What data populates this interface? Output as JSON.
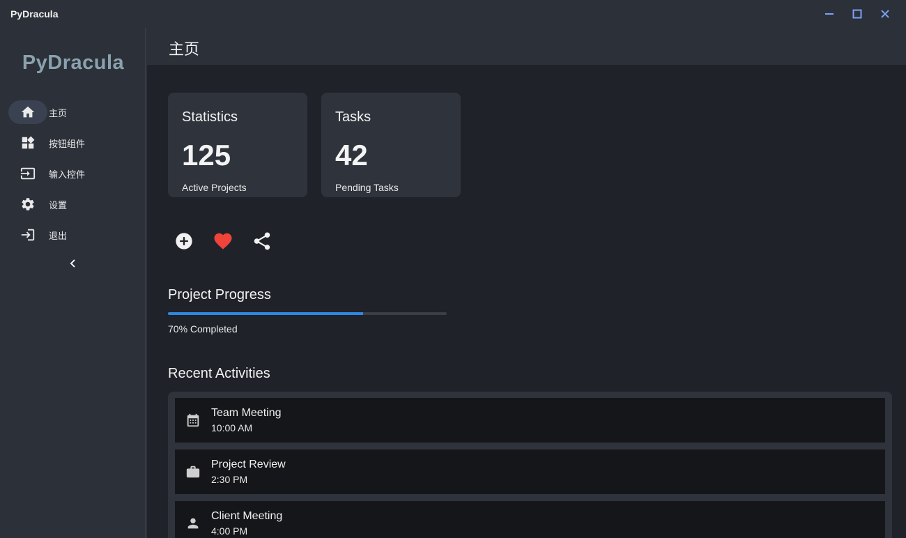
{
  "window": {
    "title": "PyDracula",
    "controls": {
      "minimize": "minimize-icon",
      "maximize": "maximize-icon",
      "close": "close-icon"
    }
  },
  "sidebar": {
    "brand": "PyDracula",
    "items": [
      {
        "label": "主页",
        "icon": "home-icon",
        "active": true
      },
      {
        "label": "按钮组件",
        "icon": "widgets-icon",
        "active": false
      },
      {
        "label": "输入控件",
        "icon": "input-icon",
        "active": false
      },
      {
        "label": "设置",
        "icon": "gear-icon",
        "active": false
      },
      {
        "label": "退出",
        "icon": "logout-icon",
        "active": false
      }
    ],
    "collapse_icon": "chevron-left-icon"
  },
  "header": {
    "title": "主页"
  },
  "cards": [
    {
      "title": "Statistics",
      "value": "125",
      "subtitle": "Active Projects"
    },
    {
      "title": "Tasks",
      "value": "42",
      "subtitle": "Pending Tasks"
    }
  ],
  "actions": [
    {
      "icon": "add-circle-icon",
      "color": "#f1f1f1"
    },
    {
      "icon": "heart-icon",
      "color": "#f0443a"
    },
    {
      "icon": "share-icon",
      "color": "#f1f1f1"
    }
  ],
  "progress": {
    "title": "Project Progress",
    "value": 0.7,
    "label": "70% Completed",
    "color": "#2f87e0"
  },
  "activities": {
    "title": "Recent Activities",
    "items": [
      {
        "icon": "calendar-icon",
        "title": "Team Meeting",
        "time": "10:00 AM"
      },
      {
        "icon": "briefcase-icon",
        "title": "Project Review",
        "time": "2:30 PM"
      },
      {
        "icon": "person-icon",
        "title": "Client Meeting",
        "time": "4:00 PM"
      }
    ]
  }
}
